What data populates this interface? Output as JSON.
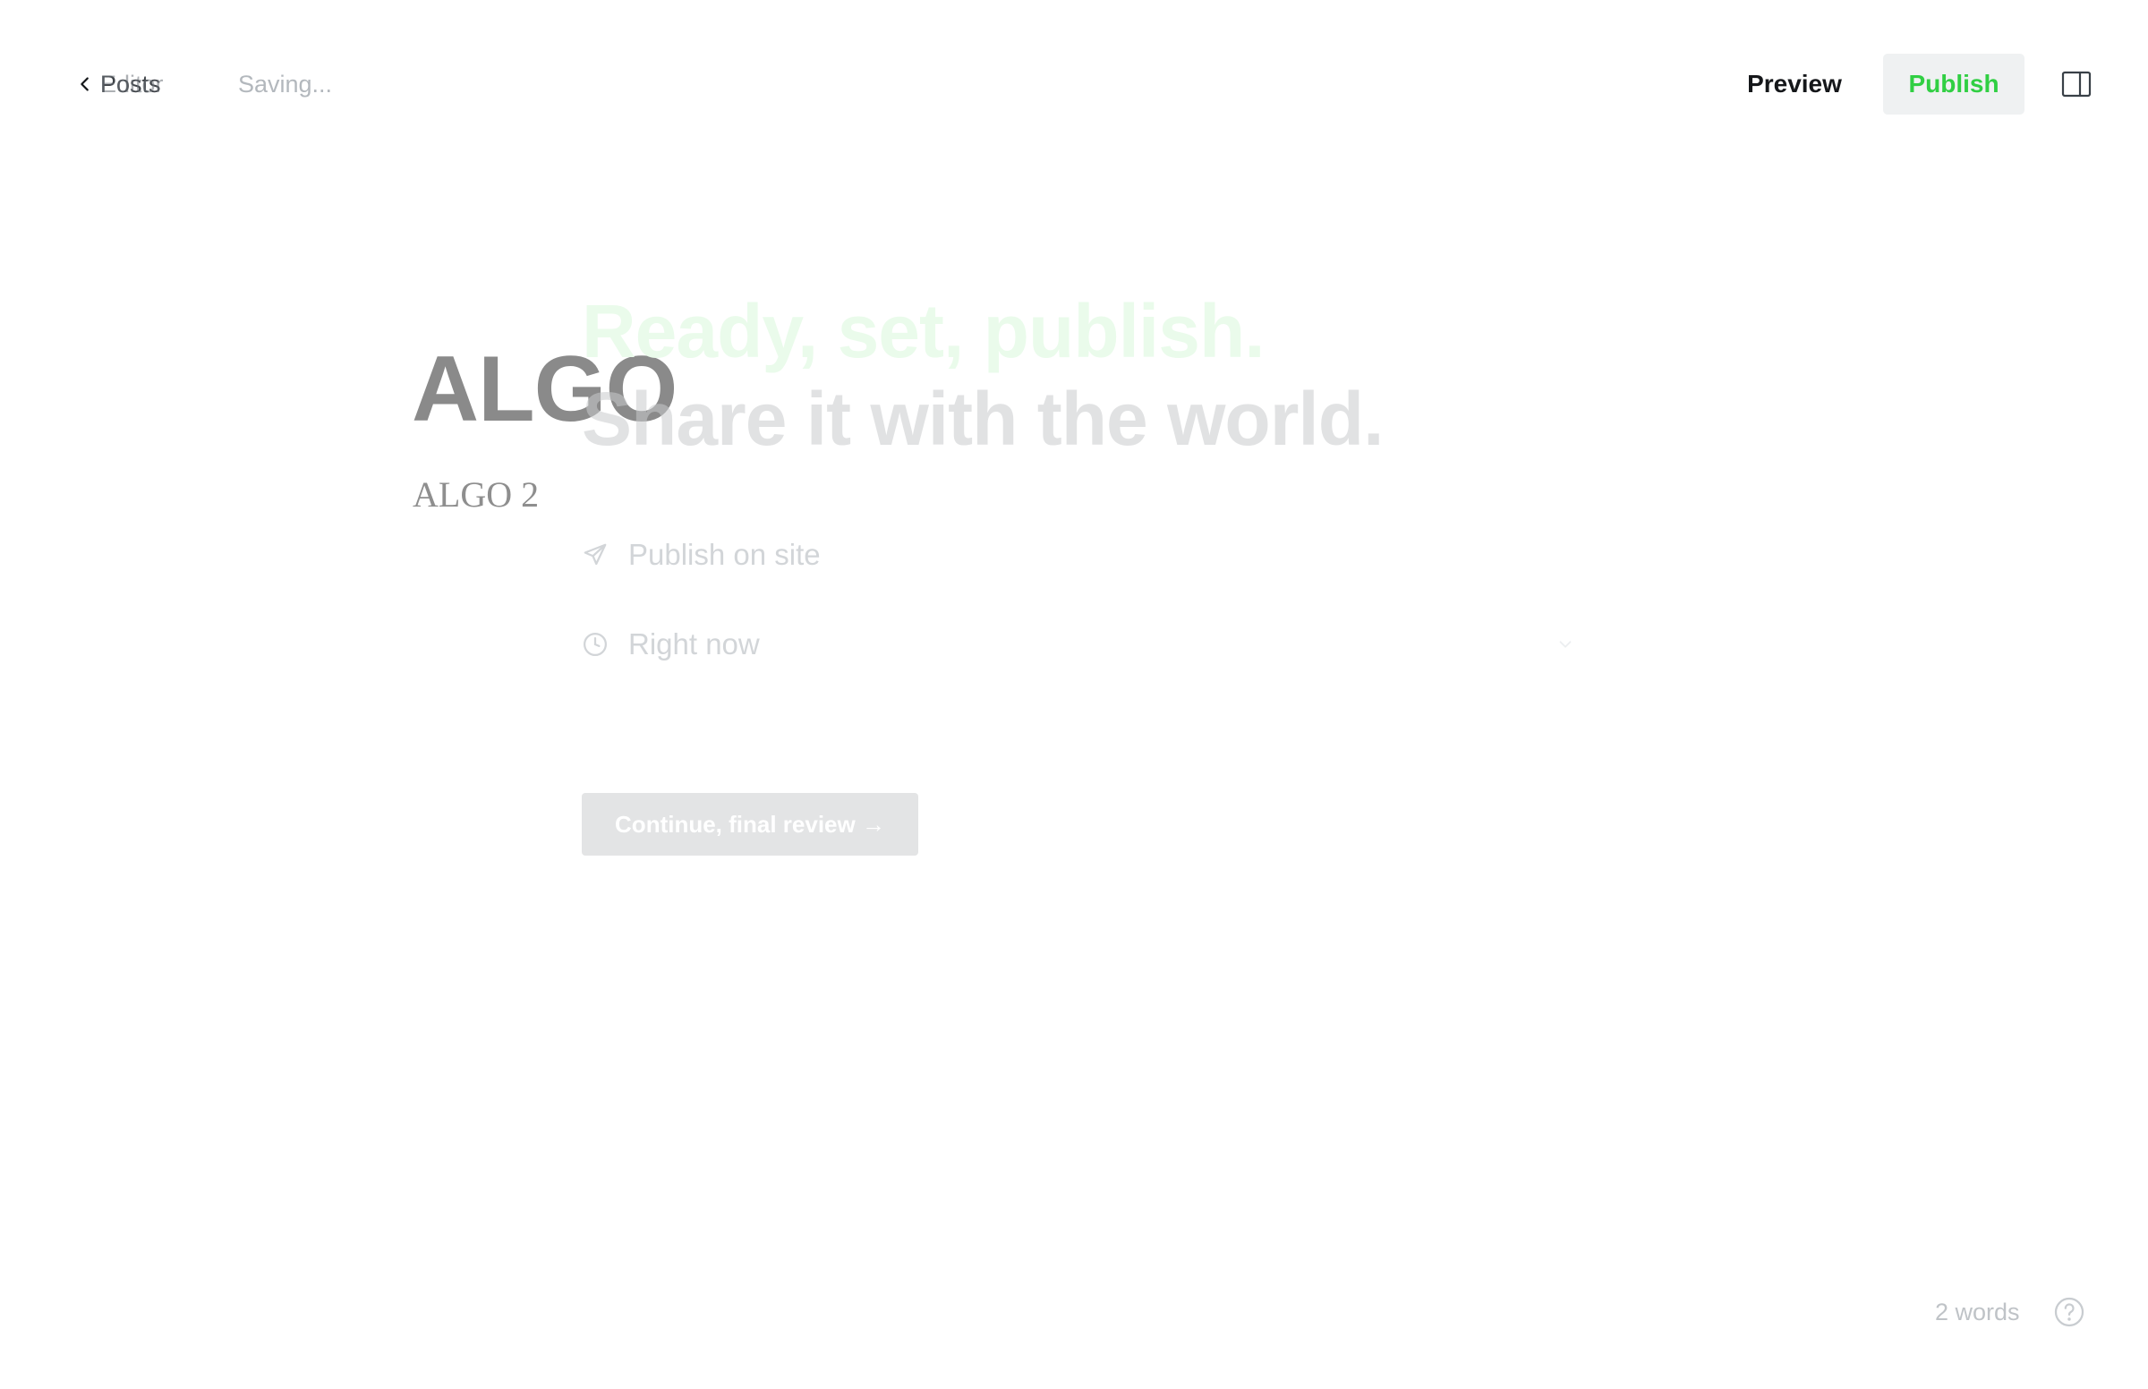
{
  "topbar": {
    "back_label": "Posts",
    "back_label_overlay": "Editor",
    "status": "Saving...",
    "preview_label": "Preview",
    "publish_label": "Publish",
    "back_icon": "chevron-left-icon",
    "sidebar_icon": "sidebar-toggle-icon"
  },
  "post": {
    "title": "ALGO",
    "excerpt": "ALGO 2"
  },
  "publish_flow": {
    "headline_1": "Ready, set, publish.",
    "headline_2": "Share it with the world.",
    "options": [
      {
        "icon": "send-icon",
        "label": "Publish on site"
      },
      {
        "icon": "clock-icon",
        "label": "Right now"
      }
    ],
    "continue_label": "Continue, final review →"
  },
  "footer": {
    "word_count": "2 words",
    "help_icon": "help-icon"
  },
  "colors": {
    "accent_green": "#30cf43",
    "headline_green": "#eafbeb",
    "button_bg": "#eff1f2"
  }
}
